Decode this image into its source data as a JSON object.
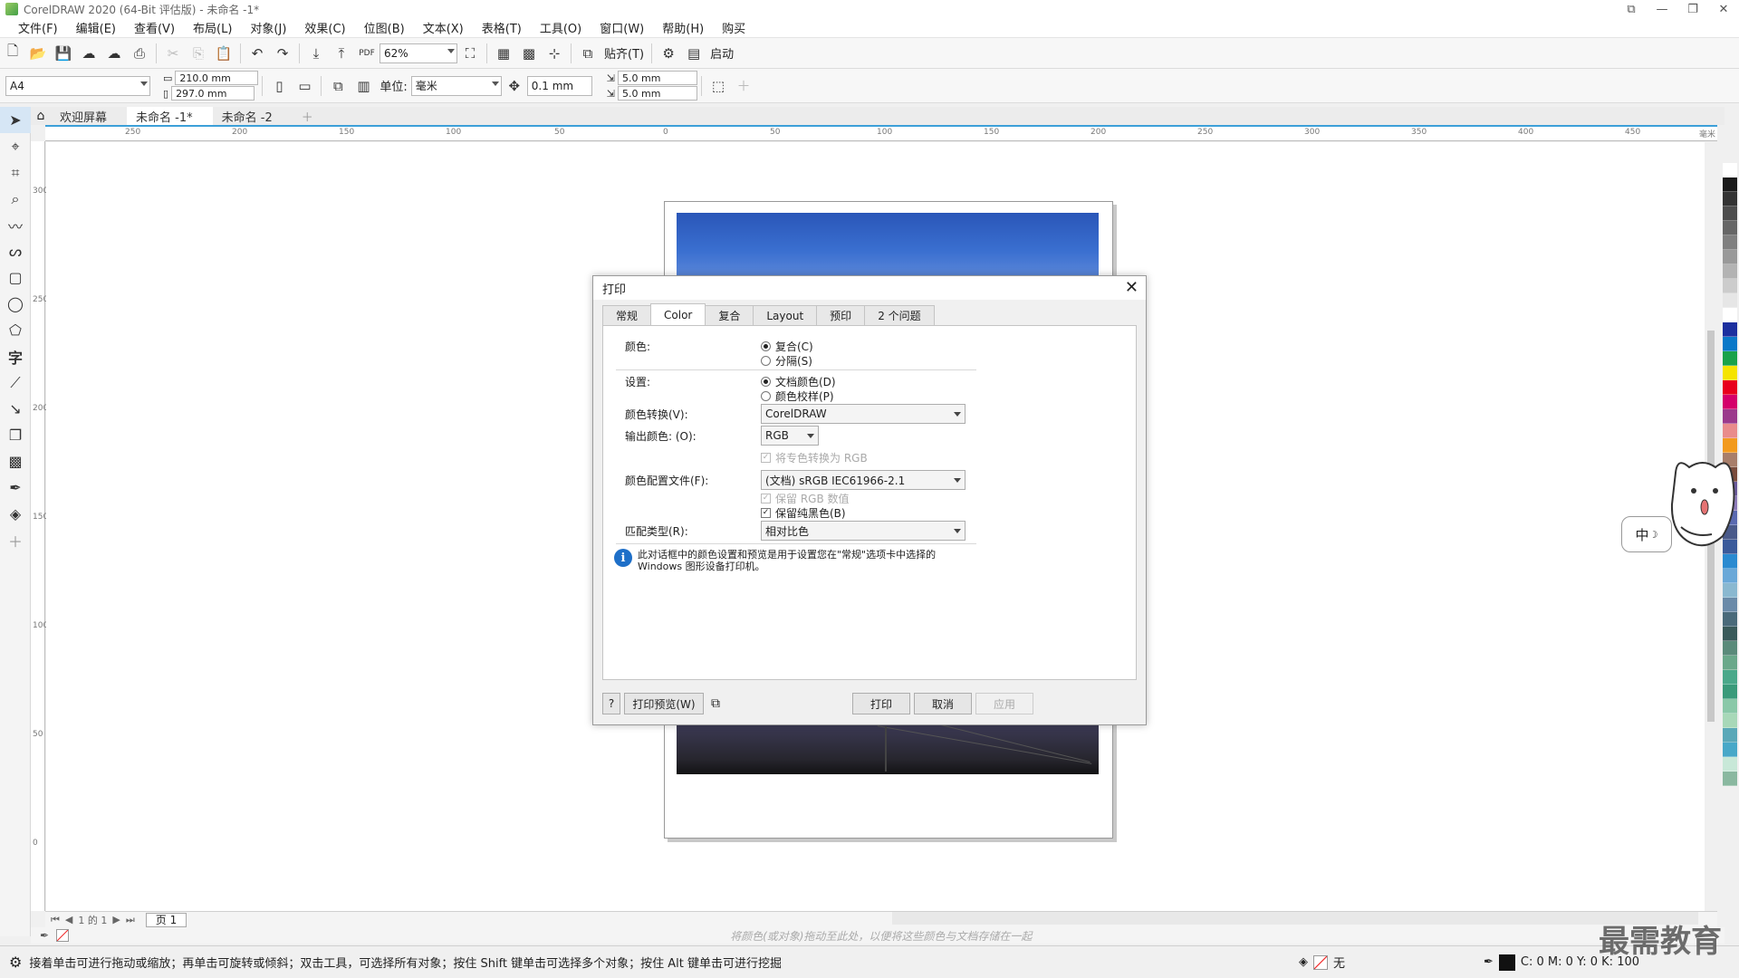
{
  "window": {
    "title": "CorelDRAW 2020 (64-Bit 评估版) - 未命名 -1*"
  },
  "menu": [
    "文件(F)",
    "编辑(E)",
    "查看(V)",
    "布局(L)",
    "对象(J)",
    "效果(C)",
    "位图(B)",
    "文本(X)",
    "表格(T)",
    "工具(O)",
    "窗口(W)",
    "帮助(H)",
    "购买"
  ],
  "toolbar1": {
    "zoom": "62%",
    "snap_label": "贴齐(T)",
    "launch_label": "启动"
  },
  "toolbar2": {
    "page_size": "A4",
    "width": "210.0 mm",
    "height": "297.0 mm",
    "unit_label": "单位:",
    "unit": "毫米",
    "nudge": "0.1 mm",
    "dup_x": "5.0 mm",
    "dup_y": "5.0 mm"
  },
  "doc_tabs": [
    "欢迎屏幕",
    "未命名 -1*",
    "未命名 -2"
  ],
  "ruler": {
    "h_ticks": [
      "250",
      "200",
      "150",
      "100",
      "50",
      "0",
      "50",
      "100",
      "150",
      "200",
      "250",
      "300",
      "350",
      "400",
      "450"
    ],
    "h_unit": "毫米",
    "v_ticks": [
      "300",
      "250",
      "200",
      "150",
      "100",
      "50",
      "0"
    ]
  },
  "page_bar": {
    "page_count": "1 的 1",
    "page_tab": "页 1"
  },
  "color_hint": "将颜色(或对象)拖动至此处，以便将这些颜色与文档存储在一起",
  "status": {
    "text": "接着单击可进行拖动或缩放；再单击可旋转或倾斜；双击工具，可选择所有对象；按住 Shift 键单击可选择多个对象；按住 Alt 键单击可进行挖掘",
    "fill_label": "无",
    "cmyk": "C: 0 M: 0 Y: 0 K: 100"
  },
  "watermark": "最需教育",
  "ime_label": "中",
  "dialog": {
    "title": "打印",
    "tabs": [
      "常规",
      "Color",
      "复合",
      "Layout",
      "预印",
      "2 个问题"
    ],
    "active_tab": "Color",
    "color_label": "颜色:",
    "composite": "复合(C)",
    "separations": "分隔(S)",
    "settings_label": "设置:",
    "doc_color": "文档颜色(D)",
    "proof_color": "颜色校样(P)",
    "conversion_label": "颜色转换(V):",
    "conversion_value": "CorelDRAW",
    "output_label": "输出颜色: (O):",
    "output_value": "RGB",
    "spot_to_rgb": "将专色转换为 RGB",
    "profile_label": "颜色配置文件(F):",
    "profile_value": "(文档)   sRGB IEC61966-2.1",
    "preserve_rgb": "保留 RGB 数值",
    "preserve_black": "保留纯黑色(B)",
    "intent_label": "匹配类型(R):",
    "intent_value": "相对比色",
    "info": "此对话框中的颜色设置和预览是用于设置您在\"常规\"选项卡中选择的 Windows 图形设备打印机。",
    "help": "?",
    "preview_btn": "打印预览(W)",
    "print_btn": "打印",
    "cancel_btn": "取消",
    "apply_btn": "应用"
  },
  "palette_colors": [
    "#ffffff",
    "#1a1a1a",
    "#333333",
    "#4d4d4d",
    "#666666",
    "#808080",
    "#999999",
    "#b3b3b3",
    "#cccccc",
    "#e6e6e6",
    "#ffffff",
    "#1c2f9e",
    "#0a78c8",
    "#1aa24a",
    "#f5e400",
    "#e8001c",
    "#d4006a",
    "#9b3a8c",
    "#e98b8b",
    "#f29a1e",
    "#a87e6a",
    "#7a4c3c",
    "#6a5a9a",
    "#8c7ab8",
    "#5a6ab0",
    "#4a5a8a",
    "#3a5a9a",
    "#2a8ad0",
    "#6aa8d8",
    "#8ab8d0",
    "#6a8aa8",
    "#4a6a7a",
    "#3a5a5a",
    "#5a8a7a",
    "#6aa88a",
    "#4aa88a",
    "#3a9a7a",
    "#8ac8a8",
    "#a8d8b8",
    "#5aa8b8",
    "#48a8c8",
    "#c8e8d8",
    "#8ab8a0"
  ]
}
